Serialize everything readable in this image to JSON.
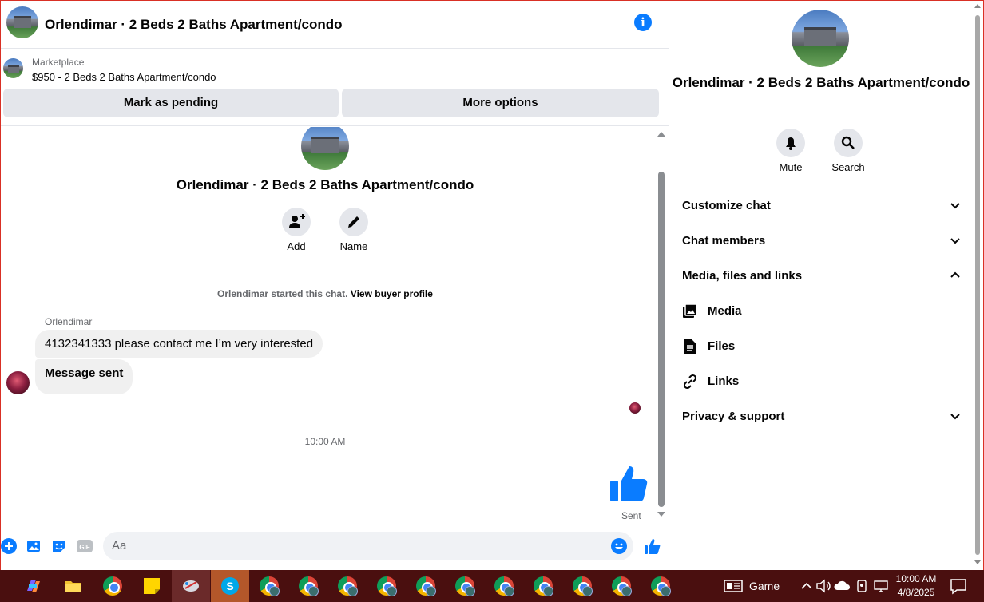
{
  "header": {
    "title": "Orlendimar · 2 Beds 2 Baths Apartment/condo"
  },
  "marketplace": {
    "label": "Marketplace",
    "listing": "$950 - 2 Beds 2 Baths Apartment/condo",
    "mark_pending": "Mark as pending",
    "more_options": "More options"
  },
  "conversation": {
    "name": "Orlendimar · 2 Beds 2 Baths Apartment/condo",
    "actions": [
      {
        "label": "Add",
        "icon": "add-person-icon"
      },
      {
        "label": "Name",
        "icon": "pencil-icon"
      }
    ],
    "system_text": "Orlendimar started this chat.",
    "system_link": "View buyer profile",
    "sender": "Orlendimar",
    "messages": [
      "4132341333 please contact me I’m very interested",
      "Message sent"
    ],
    "timestamp": "10:00 AM",
    "sent_label": "Sent"
  },
  "composer": {
    "placeholder": "Aa",
    "gif_label": "GIF"
  },
  "info": {
    "title": "Orlendimar · 2 Beds 2 Baths Apartment/condo",
    "actions": [
      {
        "label": "Mute",
        "icon": "bell-icon"
      },
      {
        "label": "Search",
        "icon": "search-icon"
      }
    ],
    "sections": [
      {
        "label": "Customize chat",
        "expanded": false
      },
      {
        "label": "Chat members",
        "expanded": false
      },
      {
        "label": "Media, files and links",
        "expanded": true
      },
      {
        "label": "Privacy & support",
        "expanded": false
      }
    ],
    "media_items": [
      {
        "label": "Media",
        "icon": "image-icon"
      },
      {
        "label": "Files",
        "icon": "file-icon"
      },
      {
        "label": "Links",
        "icon": "link-icon"
      }
    ]
  },
  "taskbar": {
    "game_label": "Game",
    "time": "10:00 AM",
    "date": "4/8/2025"
  },
  "colors": {
    "accent": "#0a7cff",
    "bubble": "#f0f0f0",
    "button_gray": "#e4e6eb",
    "taskbar": "#4a0f0f"
  }
}
